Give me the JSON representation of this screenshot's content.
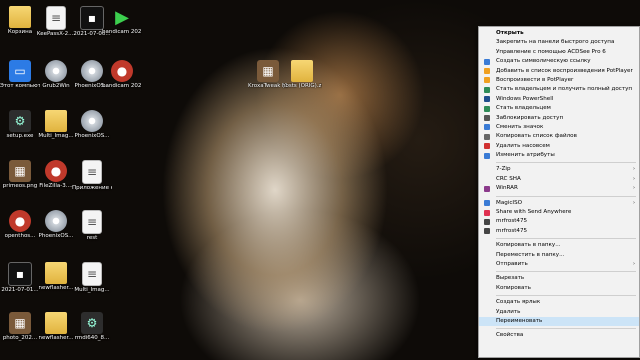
{
  "desktop_icons": [
    {
      "label": "Корзина",
      "glyph": "folder",
      "icon": "recycle-bin-icon"
    },
    {
      "label": "KeePassX-2....",
      "glyph": "file",
      "icon": "zip-file-icon"
    },
    {
      "label": "2021-07-06...",
      "glyph": "black",
      "icon": "video-file-icon"
    },
    {
      "label": "bandicam 2021-07-15...",
      "glyph": "green",
      "icon": "bandicam-icon"
    },
    {
      "label": "Этот компьютер",
      "glyph": "pc",
      "icon": "computer-icon"
    },
    {
      "label": "Grub2Win",
      "glyph": "disc",
      "icon": "grub2win-icon"
    },
    {
      "label": "PhoenixOS...",
      "glyph": "disc",
      "icon": "disc-image-icon"
    },
    {
      "label": "bandicam 2021-07-15...",
      "glyph": "red",
      "icon": "bandicam-video-icon"
    },
    {
      "label": "setup.exe",
      "glyph": "exe",
      "icon": "exe-icon"
    },
    {
      "label": "Multi_Imag...",
      "glyph": "folder",
      "icon": "folder-icon"
    },
    {
      "label": "PhoenixOS...",
      "glyph": "disc",
      "icon": "disc-image-icon"
    },
    {
      "label": "primeos.png",
      "glyph": "img",
      "icon": "image-file-icon"
    },
    {
      "label": "FileZilla-3....",
      "glyph": "red",
      "icon": "filezilla-icon"
    },
    {
      "label": "Приложение к сайту...",
      "glyph": "file",
      "icon": "document-icon"
    },
    {
      "label": "openthos...",
      "glyph": "red",
      "icon": "openthos-icon"
    },
    {
      "label": "PhoenixOS...",
      "glyph": "disc",
      "icon": "disc-image-icon"
    },
    {
      "label": "rest",
      "glyph": "file",
      "icon": "text-file-icon"
    },
    {
      "label": "2021-07-01...",
      "glyph": "black",
      "icon": "video-file-icon"
    },
    {
      "label": "newflasher...",
      "glyph": "folder",
      "icon": "folder-icon"
    },
    {
      "label": "Multi_Imag...",
      "glyph": "file",
      "icon": "text-file-icon"
    },
    {
      "label": "photo_202...",
      "glyph": "img",
      "icon": "image-file-icon"
    },
    {
      "label": "newflasher...",
      "glyph": "folder",
      "icon": "folder-icon"
    },
    {
      "label": "rmdi640_8...",
      "glyph": "exe",
      "icon": "exe-icon"
    },
    {
      "label": "KroxaTweak (1.4.1 BETA)...",
      "glyph": "img",
      "icon": "app-icon"
    },
    {
      "label": "hosts (ORIG).zip",
      "glyph": "folder",
      "icon": "zip-archive-icon"
    }
  ],
  "context_menu": {
    "items": [
      {
        "label": "Открыть",
        "bold": true,
        "icon": "",
        "color": "",
        "arrow": false
      },
      {
        "label": "Закрепить на панели быстрого доступа",
        "icon": "",
        "color": "",
        "arrow": false
      },
      {
        "label": "Управление с помощью ACDSee Pro 6",
        "icon": "",
        "color": "",
        "arrow": false
      },
      {
        "label": "Создать символическую ссылку",
        "icon": "link-icon",
        "color": "#3a7bd5",
        "arrow": false
      },
      {
        "label": "Добавить в список воспроизведения PotPlayer",
        "icon": "potplayer-icon",
        "color": "#f0a020",
        "arrow": false
      },
      {
        "label": "Воспроизвести в PotPlayer",
        "icon": "potplayer-icon",
        "color": "#f0a020",
        "arrow": false
      },
      {
        "label": "Стать владельцем и получить полный доступ",
        "icon": "shield-icon",
        "color": "#2e8b57",
        "arrow": false
      },
      {
        "label": "Windows PowerShell",
        "icon": "powershell-icon",
        "color": "#1f4e8c",
        "arrow": false
      },
      {
        "label": "Стать владельцем",
        "icon": "shield-icon",
        "color": "#2e8b57",
        "arrow": false
      },
      {
        "label": "Заблокировать доступ",
        "icon": "lock-icon",
        "color": "#555555",
        "arrow": false
      },
      {
        "label": "Сменить значок",
        "icon": "image-icon",
        "color": "#3a7bd5",
        "arrow": false
      },
      {
        "label": "Копировать список файлов",
        "icon": "list-icon",
        "color": "#666666",
        "arrow": false
      },
      {
        "label": "Удалить насовсем",
        "icon": "delete-icon",
        "color": "#d03030",
        "arrow": false
      },
      {
        "label": "Изменить атрибуты",
        "icon": "attributes-icon",
        "color": "#3a7bd5",
        "arrow": false
      },
      {
        "sep": true
      },
      {
        "label": "7-Zip",
        "icon": "",
        "color": "",
        "arrow": true
      },
      {
        "label": "CRC SHA",
        "icon": "",
        "color": "",
        "arrow": true
      },
      {
        "label": "WinRAR",
        "icon": "winrar-icon",
        "color": "#8b3a8b",
        "arrow": true
      },
      {
        "sep": true
      },
      {
        "label": "MagicISO",
        "icon": "magiciso-icon",
        "color": "#3a7bd5",
        "arrow": true
      },
      {
        "label": "Share with Send Anywhere",
        "icon": "share-icon",
        "color": "#e03050",
        "arrow": false
      },
      {
        "label": "mrfrost475",
        "icon": "user-icon",
        "color": "#444444",
        "arrow": false
      },
      {
        "label": "mrfrost475",
        "icon": "user-icon",
        "color": "#444444",
        "arrow": false
      },
      {
        "sep": true
      },
      {
        "label": "Копировать в папку...",
        "icon": "",
        "color": "",
        "arrow": false
      },
      {
        "label": "Переместить в папку...",
        "icon": "",
        "color": "",
        "arrow": false
      },
      {
        "label": "Отправить",
        "icon": "",
        "color": "",
        "arrow": true
      },
      {
        "sep": true
      },
      {
        "label": "Вырезать",
        "icon": "",
        "color": "",
        "arrow": false
      },
      {
        "label": "Копировать",
        "icon": "",
        "color": "",
        "arrow": false
      },
      {
        "sep": true
      },
      {
        "label": "Создать ярлык",
        "icon": "",
        "color": "",
        "arrow": false
      },
      {
        "label": "Удалить",
        "icon": "",
        "color": "",
        "arrow": false
      },
      {
        "label": "Переименовать",
        "icon": "",
        "color": "",
        "arrow": false,
        "highlighted": true
      },
      {
        "sep": true
      },
      {
        "label": "Свойства",
        "icon": "",
        "color": "",
        "arrow": false
      }
    ]
  },
  "colors": {
    "menu_bg": "#f2f2f2",
    "highlight": "#cce4f7"
  }
}
